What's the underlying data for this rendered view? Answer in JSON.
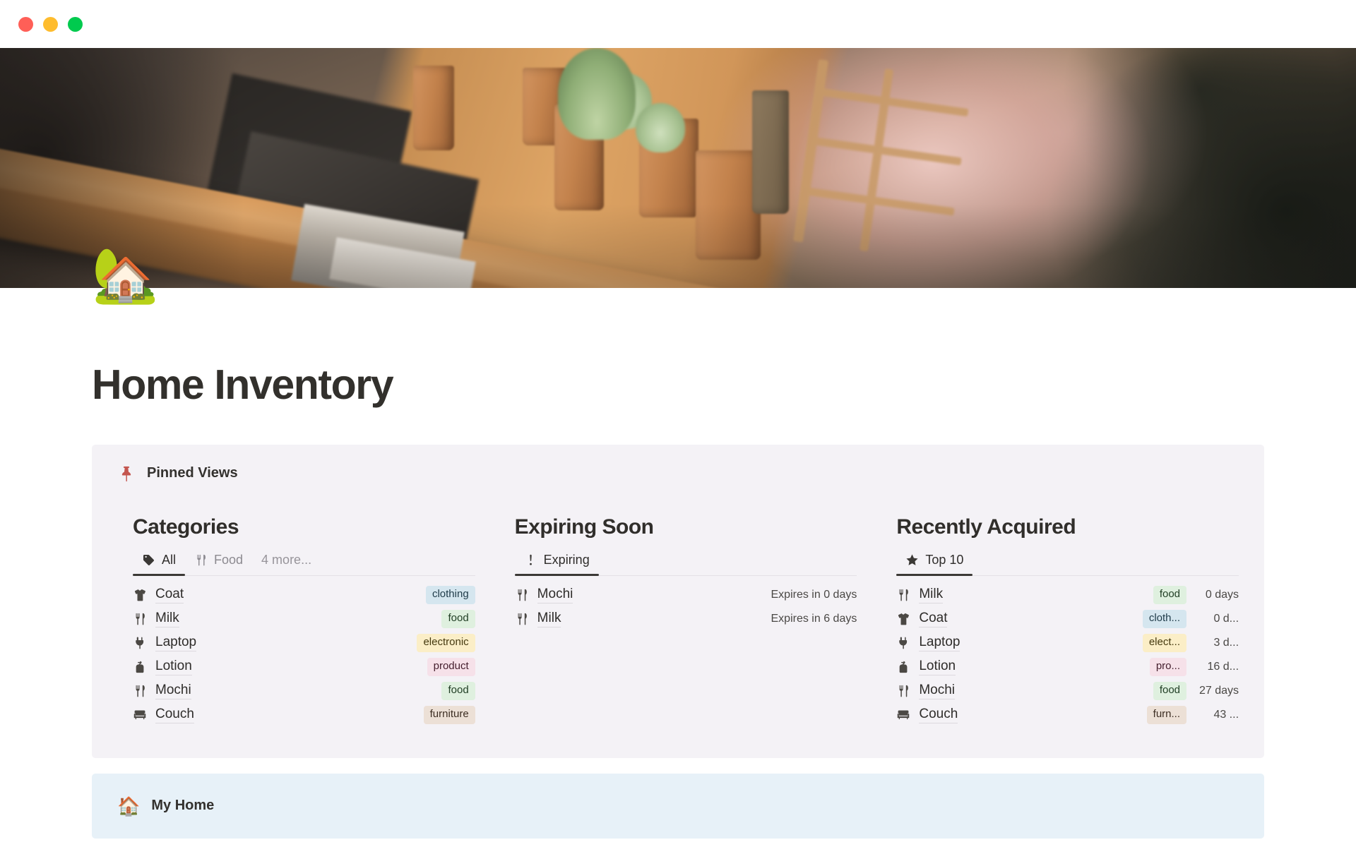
{
  "window": {
    "traffic_lights": [
      {
        "name": "close",
        "color": "#ff5f57"
      },
      {
        "name": "minimize",
        "color": "#febc2e"
      },
      {
        "name": "maximize",
        "color": "#00ca4e"
      }
    ]
  },
  "cover": {
    "alt": "potted succulents on a wooden shelf"
  },
  "page": {
    "icon": "🏡",
    "title": "Home Inventory"
  },
  "pinned_views": {
    "icon": "pushpin-icon",
    "label": "Pinned Views",
    "background": "#f4f2f6",
    "columns": [
      {
        "title": "Categories",
        "tabs": [
          {
            "label": "All",
            "icon": "tag-icon",
            "active": true
          },
          {
            "label": "Food",
            "icon": "fork-knife-icon",
            "active": false
          }
        ],
        "more_label": "4 more...",
        "rows": [
          {
            "icon": "tshirt-icon",
            "name": "Coat",
            "tag": "clothing",
            "tag_color": "#d5e6ef",
            "tag_text": "#1f3b49"
          },
          {
            "icon": "fork-knife-icon",
            "name": "Milk",
            "tag": "food",
            "tag_color": "#dff0df",
            "tag_text": "#1f3d23"
          },
          {
            "icon": "plug-icon",
            "name": "Laptop",
            "tag": "electronic",
            "tag_color": "#fbeec7",
            "tag_text": "#45390f"
          },
          {
            "icon": "lotion-icon",
            "name": "Lotion",
            "tag": "product",
            "tag_color": "#f6e1e9",
            "tag_text": "#46202f"
          },
          {
            "icon": "fork-knife-icon",
            "name": "Mochi",
            "tag": "food",
            "tag_color": "#dff0df",
            "tag_text": "#1f3d23"
          },
          {
            "icon": "couch-icon",
            "name": "Couch",
            "tag": "furniture",
            "tag_color": "#ece0d6",
            "tag_text": "#3d2e23"
          }
        ]
      },
      {
        "title": "Expiring Soon",
        "tabs": [
          {
            "label": "Expiring",
            "icon": "exclamation-icon",
            "active": true
          }
        ],
        "more_label": "",
        "rows": [
          {
            "icon": "fork-knife-icon",
            "name": "Mochi",
            "meta": "Expires in 0 days"
          },
          {
            "icon": "fork-knife-icon",
            "name": "Milk",
            "meta": "Expires in 6 days"
          }
        ]
      },
      {
        "title": "Recently Acquired",
        "tabs": [
          {
            "label": "Top 10",
            "icon": "star-icon",
            "active": true
          }
        ],
        "more_label": "",
        "rows": [
          {
            "icon": "fork-knife-icon",
            "name": "Milk",
            "tag": "food",
            "tag_color": "#dff0df",
            "tag_text": "#1f3d23",
            "meta": "0 days"
          },
          {
            "icon": "tshirt-icon",
            "name": "Coat",
            "tag": "cloth...",
            "tag_color": "#d5e6ef",
            "tag_text": "#1f3b49",
            "meta": "0 d..."
          },
          {
            "icon": "plug-icon",
            "name": "Laptop",
            "tag": "elect...",
            "tag_color": "#fbeec7",
            "tag_text": "#45390f",
            "meta": "3 d..."
          },
          {
            "icon": "lotion-icon",
            "name": "Lotion",
            "tag": "pro...",
            "tag_color": "#f6e1e9",
            "tag_text": "#46202f",
            "meta": "16 d..."
          },
          {
            "icon": "fork-knife-icon",
            "name": "Mochi",
            "tag": "food",
            "tag_color": "#dff0df",
            "tag_text": "#1f3d23",
            "meta": "27 days"
          },
          {
            "icon": "couch-icon",
            "name": "Couch",
            "tag": "furn...",
            "tag_color": "#ece0d6",
            "tag_text": "#3d2e23",
            "meta": "43 ..."
          }
        ]
      }
    ]
  },
  "my_home": {
    "icon": "🏠",
    "label": "My Home",
    "background": "#e7f1f8"
  }
}
